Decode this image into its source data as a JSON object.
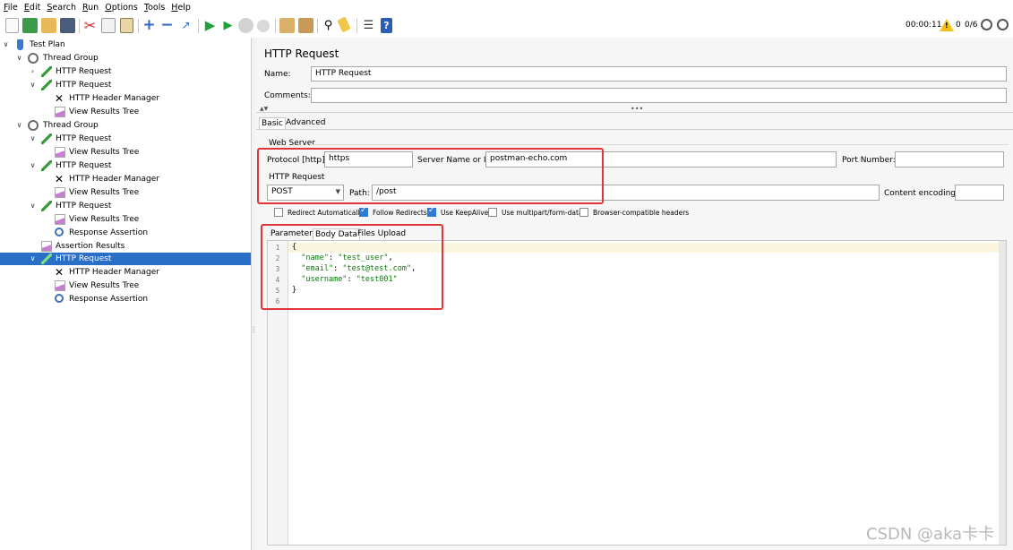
{
  "menu": [
    "File",
    "Edit",
    "Search",
    "Run",
    "Options",
    "Tools",
    "Help"
  ],
  "toolbar": {
    "timer": "00:00:11",
    "warning_count": "0",
    "threads": "0/6",
    "icons": [
      "new-icon",
      "templates-icon",
      "open-icon",
      "save-icon",
      "cut-icon",
      "copy-icon",
      "paste-icon",
      "expand-icon",
      "collapse-icon",
      "toggle-icon",
      "start-icon",
      "start-no-pauses-icon",
      "stop-icon",
      "shutdown-icon",
      "clear-icon",
      "clear-all-icon",
      "search-icon",
      "reset-search-icon",
      "function-helper-icon",
      "help-icon"
    ]
  },
  "tree": [
    {
      "label": "Test Plan",
      "icon": "test-plan-icon"
    },
    {
      "label": "Thread Group",
      "icon": "thread-group-icon"
    },
    {
      "label": "HTTP Request",
      "icon": "http-request-icon"
    },
    {
      "label": "HTTP Request",
      "icon": "http-request-icon"
    },
    {
      "label": "HTTP Header Manager",
      "icon": "header-manager-icon"
    },
    {
      "label": "View Results Tree",
      "icon": "results-tree-icon"
    },
    {
      "label": "Thread Group",
      "icon": "thread-group-icon"
    },
    {
      "label": "HTTP Request",
      "icon": "http-request-icon"
    },
    {
      "label": "View Results Tree",
      "icon": "results-tree-icon"
    },
    {
      "label": "HTTP Request",
      "icon": "http-request-icon"
    },
    {
      "label": "HTTP Header Manager",
      "icon": "header-manager-icon"
    },
    {
      "label": "View Results Tree",
      "icon": "results-tree-icon"
    },
    {
      "label": "HTTP Request",
      "icon": "http-request-icon"
    },
    {
      "label": "View Results Tree",
      "icon": "results-tree-icon"
    },
    {
      "label": "Response Assertion",
      "icon": "assertion-icon"
    },
    {
      "label": "Assertion Results",
      "icon": "assertion-results-icon"
    },
    {
      "label": "HTTP Request",
      "icon": "http-request-icon"
    },
    {
      "label": "HTTP Header Manager",
      "icon": "header-manager-icon"
    },
    {
      "label": "View Results Tree",
      "icon": "results-tree-icon"
    },
    {
      "label": "Response Assertion",
      "icon": "assertion-icon"
    }
  ],
  "panel": {
    "title": "HTTP Request",
    "name_label": "Name:",
    "name_value": "HTTP Request",
    "comments_label": "Comments:",
    "comments_value": "",
    "tabs": [
      "Basic",
      "Advanced"
    ],
    "web_server_heading": "Web Server",
    "protocol_label": "Protocol [http]:",
    "protocol_value": "https",
    "server_label": "Server Name or IP:",
    "server_value": "postman-echo.com",
    "port_label": "Port Number:",
    "port_value": "",
    "http_request_heading": "HTTP Request",
    "method_value": "POST",
    "path_label": "Path:",
    "path_value": "/post",
    "encoding_label": "Content encoding:",
    "encoding_value": "",
    "checkboxes": [
      {
        "label": "Redirect Automatically",
        "checked": false
      },
      {
        "label": "Follow Redirects",
        "checked": true
      },
      {
        "label": "Use KeepAlive",
        "checked": true
      },
      {
        "label": "Use multipart/form-data",
        "checked": false
      },
      {
        "label": "Browser-compatible headers",
        "checked": false
      }
    ],
    "subtabs": [
      "Parameters",
      "Body Data",
      "Files Upload"
    ],
    "body_lines": [
      "1",
      "2",
      "3",
      "4",
      "5",
      "6"
    ],
    "body": {
      "open": "{",
      "k1": "\"name\"",
      "v1": "\"test_user\"",
      "k2": "\"email\"",
      "v2": "\"test@test.com\"",
      "k3": "\"username\"",
      "v3": "\"test001\"",
      "close": "}"
    }
  },
  "watermark": "CSDN @aka卡卡"
}
